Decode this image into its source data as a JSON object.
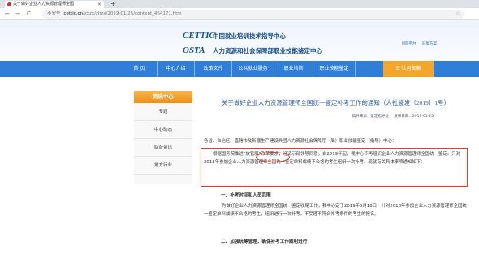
{
  "browser": {
    "tab_title": "关于做好企业人力资源管理师全国",
    "tab_close": "×",
    "new_tab": "+",
    "back": "←",
    "forward": "→",
    "reload": "C",
    "security_label": "不安全",
    "url_host": "cettic.cn",
    "url_path": "/zxzx/zhzx/2019-01/25/content_464171.htm",
    "star": "☆"
  },
  "header": {
    "logo_top": "CETTIC",
    "logo_bottom": "OSTA",
    "title_top": "中国就业培训技术指导中心",
    "title_bottom": "人力资源和社会保障部职业技能鉴定中心",
    "links": [
      "国际平台",
      "旧版方案"
    ]
  },
  "nav": {
    "items": [
      "首 页",
      "中心介绍",
      "政策文件",
      "公共就业服务",
      "职业培训",
      "职业技能鉴定",
      "☰ 社务邮箱"
    ]
  },
  "sidebar": {
    "heading": "资讯中心",
    "items": [
      "专题",
      "中心动态",
      "综合资讯",
      "地方行业"
    ]
  },
  "article": {
    "title": "关于做好企业人力资源管理师全国统一鉴定补考工作的通知（人社鉴发〔2019〕1号）",
    "meta_source": "稿件来源：鉴定指导处",
    "meta_date": "发布日期：2019-01-25",
    "salutation": "各省、自治区、直辖市及新疆生产建设兵团人力资源社会保障厅（局）职业技能鉴定（指导）中心：",
    "intro": "根据国务院推进“放管服”改革要求，经请示部领导同意，自2019年起，我中心不再组织企业人力资源管理师全国统一鉴定。只对2018年参加企业人力资源管理师全国统一鉴定单科成绩不合格的考生组织一次补考。现就有关具体事项通知如下：",
    "section1": "一、补考时间和人员范围",
    "section1_text": "为做好企业人力资源管理师全国统一鉴定收尾工作，我中心定于2019年5月18日，针对2018年参加企业人力资源管理师全国统一鉴定单科成绩不合格的考生，组织进行一次补考，不受理不符合补考条件的考生的报名。",
    "section2": "二、加强统筹管理，确保补考工作顺利进行"
  }
}
